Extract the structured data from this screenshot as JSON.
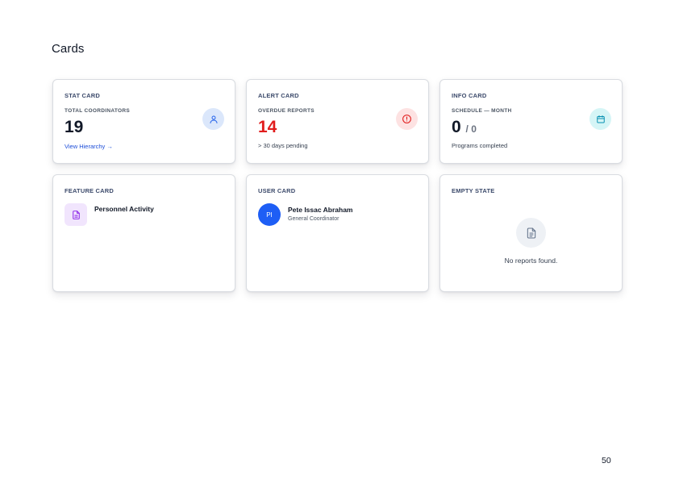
{
  "page": {
    "title": "Cards",
    "number": "50"
  },
  "stat_card": {
    "label": "STAT CARD",
    "stat_label": "TOTAL COORDINATORS",
    "value": "19",
    "link": "View Hierarchy →",
    "icon": "user-icon",
    "accent": "#2563eb"
  },
  "alert_card": {
    "label": "ALERT CARD",
    "stat_label": "OVERDUE REPORTS",
    "value": "14",
    "note": "> 30 days pending",
    "icon": "alert-circle-icon",
    "accent": "#e11d1d"
  },
  "info_card": {
    "label": "INFO CARD",
    "stat_label": "SCHEDULE — MONTH",
    "value": "0",
    "value_total": "/ 0",
    "note": "Programs completed",
    "icon": "calendar-icon",
    "accent": "#0891b2"
  },
  "feature_card": {
    "label": "FEATURE CARD",
    "title": "Personnel Activity",
    "icon": "document-icon",
    "accent": "#9333ea"
  },
  "user_card": {
    "label": "USER CARD",
    "initials": "PI",
    "name": "Pete Issac Abraham",
    "role": "General Coordinator",
    "avatar_color": "#1e5ef5"
  },
  "empty_card": {
    "label": "EMPTY STATE",
    "message": "No reports found.",
    "icon": "document-icon"
  }
}
